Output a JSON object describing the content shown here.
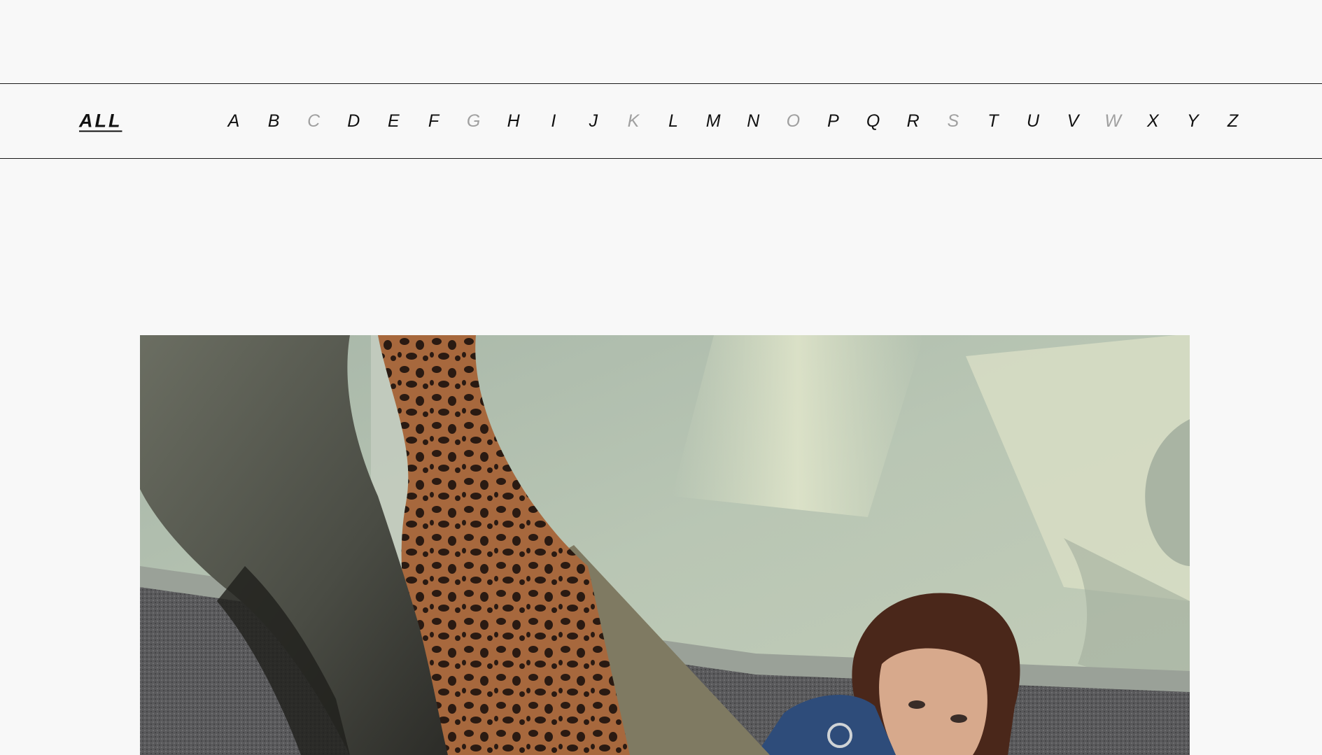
{
  "filter": {
    "all_label": "ALL",
    "letters": [
      {
        "label": "A",
        "enabled": true
      },
      {
        "label": "B",
        "enabled": true
      },
      {
        "label": "C",
        "enabled": false
      },
      {
        "label": "D",
        "enabled": true
      },
      {
        "label": "E",
        "enabled": true
      },
      {
        "label": "F",
        "enabled": true
      },
      {
        "label": "G",
        "enabled": false
      },
      {
        "label": "H",
        "enabled": true
      },
      {
        "label": "I",
        "enabled": true
      },
      {
        "label": "J",
        "enabled": true
      },
      {
        "label": "K",
        "enabled": false
      },
      {
        "label": "L",
        "enabled": true
      },
      {
        "label": "M",
        "enabled": true
      },
      {
        "label": "N",
        "enabled": true
      },
      {
        "label": "O",
        "enabled": false
      },
      {
        "label": "P",
        "enabled": true
      },
      {
        "label": "Q",
        "enabled": true
      },
      {
        "label": "R",
        "enabled": true
      },
      {
        "label": "S",
        "enabled": false
      },
      {
        "label": "T",
        "enabled": true
      },
      {
        "label": "U",
        "enabled": true
      },
      {
        "label": "V",
        "enabled": true
      },
      {
        "label": "W",
        "enabled": false
      },
      {
        "label": "X",
        "enabled": true
      },
      {
        "label": "Y",
        "enabled": true
      },
      {
        "label": "Z",
        "enabled": true
      }
    ]
  },
  "colors": {
    "background": "#f8f8f8",
    "text": "#111111",
    "disabled_text": "#a0a0a0",
    "rule": "#1a1a1a"
  }
}
